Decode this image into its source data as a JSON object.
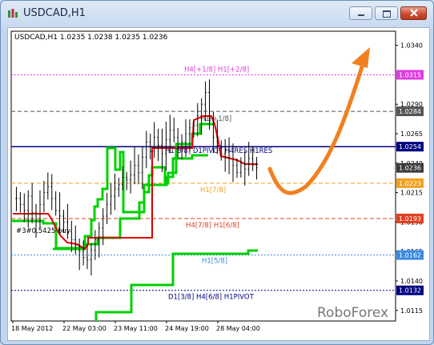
{
  "window": {
    "title": "USDCAD,H1"
  },
  "chart_info": "USDCAD,H1  1.0235 1.0238 1.0235 1.0236",
  "watermark": "RoboForex",
  "colors": {
    "murrey_h1": "#00d000",
    "dynamic_line": "#e00000",
    "grid": "#888888",
    "arrow": "#f08020",
    "h4_level": "#e03ce0",
    "res_level": "#000080"
  },
  "chart_data": {
    "type": "candlestick",
    "y_ticks": [
      "1.0340",
      "1.0315",
      "1.0290",
      "1.0284",
      "1.0265",
      "1.0254",
      "1.0236",
      "1.0240",
      "1.0223",
      "1.0215",
      "1.0193",
      "1.0190",
      "1.0162",
      "1.0165",
      "1.0140",
      "1.0132",
      "1.0115"
    ],
    "ylim": [
      1.0106,
      1.0352
    ],
    "x_ticks": [
      "18 May 2012",
      "22 May 03:00",
      "23 May 11:00",
      "24 May 19:00",
      "28 May 04:00"
    ],
    "levels": [
      {
        "label": "H4[+1/8] H1[+2/8]",
        "value": 1.0315,
        "color": "#e03ce0",
        "style": "dotted",
        "badge": "1.0315"
      },
      {
        "label": "H1[+1/8]",
        "value": 1.0284,
        "color": "#555555",
        "style": "dashed",
        "badge": "1.0284"
      },
      {
        "label": "H1[8/8] D1PIVOT H4RES H1RES",
        "value": 1.0254,
        "color": "#000080",
        "style": "solid",
        "badge": "1.0254"
      },
      {
        "label": "",
        "value": 1.0236,
        "color": "#aaaaaa",
        "style": "none",
        "badge": "1.0236"
      },
      {
        "label": "H1[7/8]",
        "value": 1.0223,
        "color": "#f0a020",
        "style": "dashed",
        "badge": "1.0223"
      },
      {
        "label": "H4[7/8] H1[6/8]",
        "value": 1.0193,
        "color": "#e04020",
        "style": "dashed",
        "badge": "1.0193"
      },
      {
        "label": "H1[5/8]",
        "value": 1.0162,
        "color": "#3a8ae0",
        "style": "dotted",
        "badge": "1.0162"
      },
      {
        "label": "D1[3/8] H4[6/8] H1PIVOT",
        "value": 1.0132,
        "color": "#000080",
        "style": "dotted",
        "badge": "1.0132"
      }
    ],
    "left_label": "#3#0.5425 buy",
    "close_series": [
      1.021,
      1.0205,
      1.02,
      1.0212,
      1.0198,
      1.019,
      1.0205,
      1.0215,
      1.022,
      1.021,
      1.02,
      1.0195,
      1.019,
      1.0182,
      1.0175,
      1.017,
      1.0165,
      1.016,
      1.0158,
      1.0166,
      1.0175,
      1.0185,
      1.0195,
      1.0205,
      1.0212,
      1.0218,
      1.0222,
      1.0228,
      1.0226,
      1.023,
      1.0238,
      1.0232,
      1.0245,
      1.0258,
      1.025,
      1.0262,
      1.0255,
      1.0248,
      1.026,
      1.0268,
      1.0262,
      1.0252,
      1.0258,
      1.0265,
      1.027,
      1.0272,
      1.028,
      1.029,
      1.03,
      1.0278,
      1.0262,
      1.0255,
      1.0248,
      1.0245,
      1.025,
      1.0238,
      1.0232,
      1.024,
      1.0235,
      1.0244,
      1.0238,
      1.0236
    ]
  }
}
